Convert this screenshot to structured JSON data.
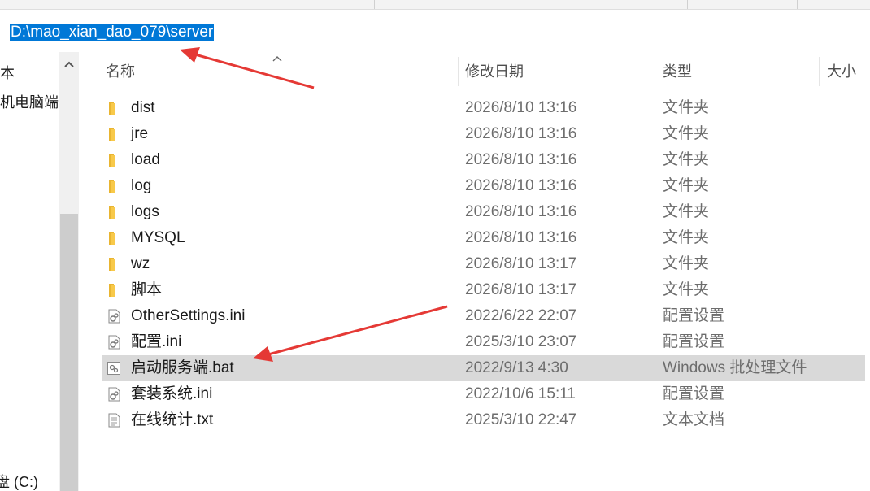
{
  "address": {
    "path": "D:\\mao_xian_dao_079\\server"
  },
  "nav": {
    "items": [
      {
        "label": "本",
        "icon": ""
      },
      {
        "label": "机电脑端",
        "icon": ""
      },
      {
        "label": "盘 (C:)",
        "icon": "drive-icon"
      }
    ]
  },
  "columns": {
    "name": "名称",
    "date": "修改日期",
    "type": "类型",
    "size": "大小"
  },
  "files": [
    {
      "name": "dist",
      "date": "2026/8/10 13:16",
      "type": "文件夹",
      "icon": "folder-icon"
    },
    {
      "name": "jre",
      "date": "2026/8/10 13:16",
      "type": "文件夹",
      "icon": "folder-icon"
    },
    {
      "name": "load",
      "date": "2026/8/10 13:16",
      "type": "文件夹",
      "icon": "folder-icon"
    },
    {
      "name": "log",
      "date": "2026/8/10 13:16",
      "type": "文件夹",
      "icon": "folder-icon"
    },
    {
      "name": "logs",
      "date": "2026/8/10 13:16",
      "type": "文件夹",
      "icon": "folder-icon"
    },
    {
      "name": "MYSQL",
      "date": "2026/8/10 13:16",
      "type": "文件夹",
      "icon": "folder-icon"
    },
    {
      "name": "wz",
      "date": "2026/8/10 13:17",
      "type": "文件夹",
      "icon": "folder-icon"
    },
    {
      "name": "脚本",
      "date": "2026/8/10 13:17",
      "type": "文件夹",
      "icon": "folder-icon"
    },
    {
      "name": "OtherSettings.ini",
      "date": "2022/6/22 22:07",
      "type": "配置设置",
      "icon": "settings-file-icon"
    },
    {
      "name": "配置.ini",
      "date": "2025/3/10 23:07",
      "type": "配置设置",
      "icon": "settings-file-icon"
    },
    {
      "name": "启动服务端.bat",
      "date": "2022/9/13 4:30",
      "type": "Windows 批处理文件",
      "icon": "batch-file-icon",
      "selected": true
    },
    {
      "name": "套装系统.ini",
      "date": "2022/10/6 15:11",
      "type": "配置设置",
      "icon": "settings-file-icon"
    },
    {
      "name": "在线统计.txt",
      "date": "2025/3/10 22:47",
      "type": "文本文档",
      "icon": "text-file-icon"
    }
  ],
  "colors": {
    "selection": "#0078d7",
    "row_highlight": "#d9d9d9",
    "folder": "#f8c94a",
    "annotation_arrow": "#e53935"
  }
}
